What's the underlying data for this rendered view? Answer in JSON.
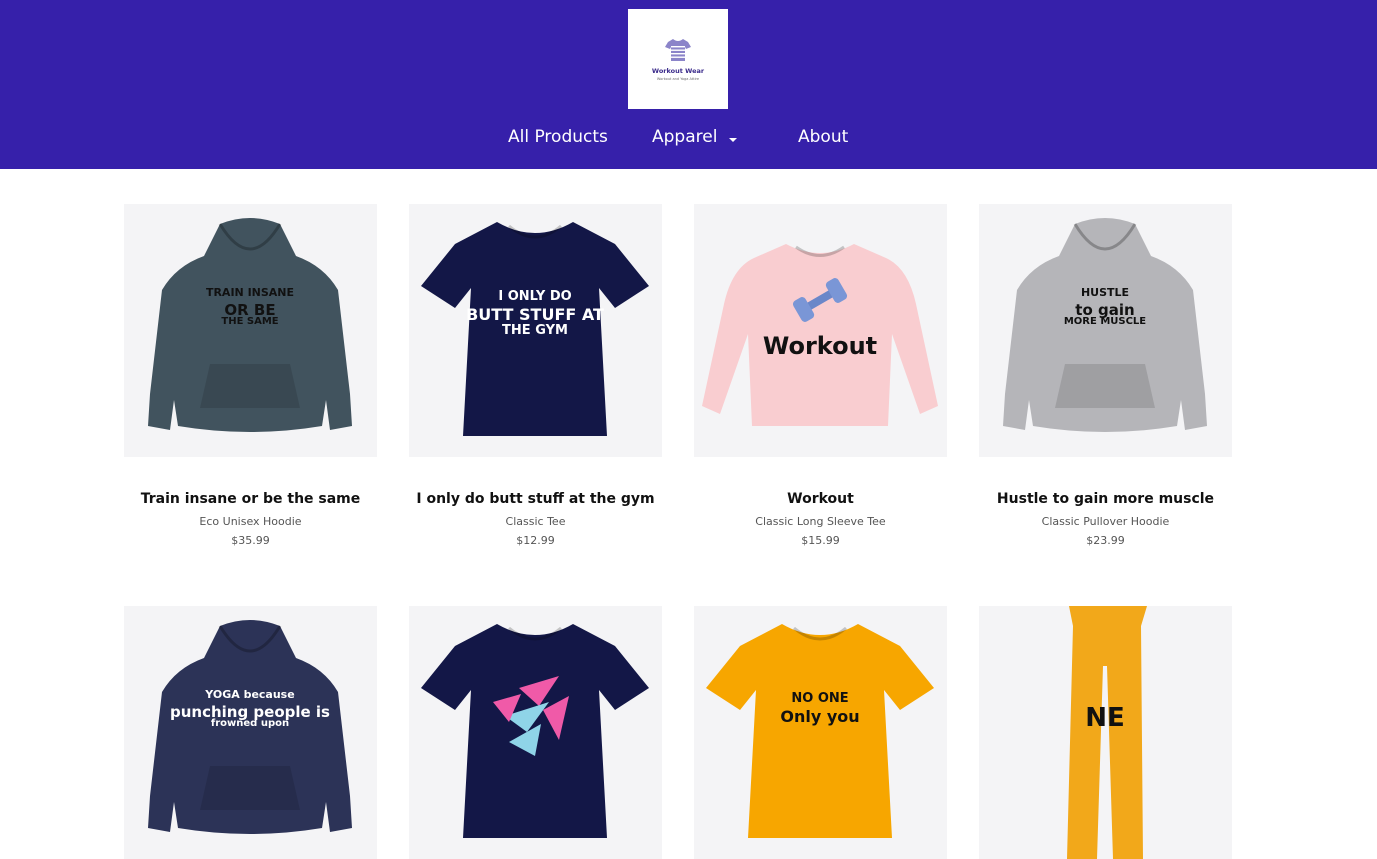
{
  "brand": {
    "name": "Workout Wear",
    "tagline": "Workout and Yoga Attire",
    "colors": {
      "header": "#3620aa",
      "card_bg": "#f4f4f6"
    },
    "icon": "striped-tshirt-icon"
  },
  "nav": {
    "items": [
      {
        "label": "All Products"
      },
      {
        "label": "Apparel",
        "has_dropdown": true
      },
      {
        "label": "About"
      }
    ]
  },
  "products": [
    {
      "title": "Train insane or be the same",
      "type": "Eco Unisex Hoodie",
      "price": "$35.99",
      "garment": "hoodie",
      "garment_color": "#41535e",
      "print_lines": [
        "TRAIN INSANE",
        "OR BE",
        "THE SAME"
      ],
      "print_color": "#111111"
    },
    {
      "title": "I only do butt stuff at the gym",
      "type": "Classic Tee",
      "price": "$12.99",
      "garment": "tee",
      "garment_color": "#131747",
      "print_lines": [
        "I ONLY DO",
        "BUTT STUFF AT",
        "THE GYM"
      ],
      "print_color": "#ffffff"
    },
    {
      "title": "Workout",
      "type": "Classic Long Sleeve Tee",
      "price": "$15.99",
      "garment": "longsleeve",
      "garment_color": "#f9cdd0",
      "print_lines": [
        "Workout"
      ],
      "print_color": "#111111",
      "graphic": "dumbbells"
    },
    {
      "title": "Hustle to gain more muscle",
      "type": "Classic Pullover Hoodie",
      "price": "$23.99",
      "garment": "hoodie",
      "garment_color": "#b5b5b9",
      "print_lines": [
        "HUSTLE",
        "to gain",
        "MORE MUSCLE"
      ],
      "print_color": "#111111"
    },
    {
      "garment": "hoodie",
      "garment_color": "#2c3357",
      "print_lines": [
        "YOGA because",
        "punching people is",
        "frowned upon"
      ],
      "print_color": "#ffffff"
    },
    {
      "garment": "tee",
      "garment_color": "#131747",
      "print_lines": [],
      "graphic": "shards"
    },
    {
      "garment": "tee",
      "garment_color": "#f7a600",
      "print_lines": [
        "NO ONE",
        "Only you"
      ],
      "print_color": "#111111"
    },
    {
      "garment": "leggings",
      "garment_color": "#f2a81a",
      "print_lines": [
        "NE"
      ],
      "print_color": "#111111"
    }
  ]
}
